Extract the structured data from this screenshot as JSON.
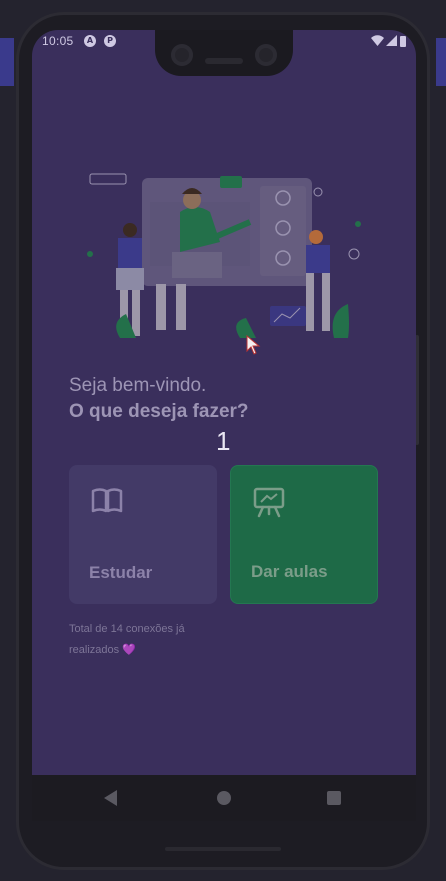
{
  "status_bar": {
    "time": "10:05",
    "icon_a": "A",
    "icon_p": "P"
  },
  "greeting": "Seja bem-vindo.",
  "question": "O que deseja fazer?",
  "overlay_counter": "1",
  "cards": {
    "study": {
      "label": "Estudar",
      "icon": "book-icon"
    },
    "teach": {
      "label": "Dar aulas",
      "icon": "presentation-icon"
    }
  },
  "total_connections": {
    "line1": "Total de 14 conexões já",
    "line2": "realizados",
    "heart": "💜"
  },
  "colors": {
    "background": "#3a2f5c",
    "study_card": "#433a67",
    "teach_card": "#1e6a47",
    "text_muted": "#9d95b5"
  }
}
